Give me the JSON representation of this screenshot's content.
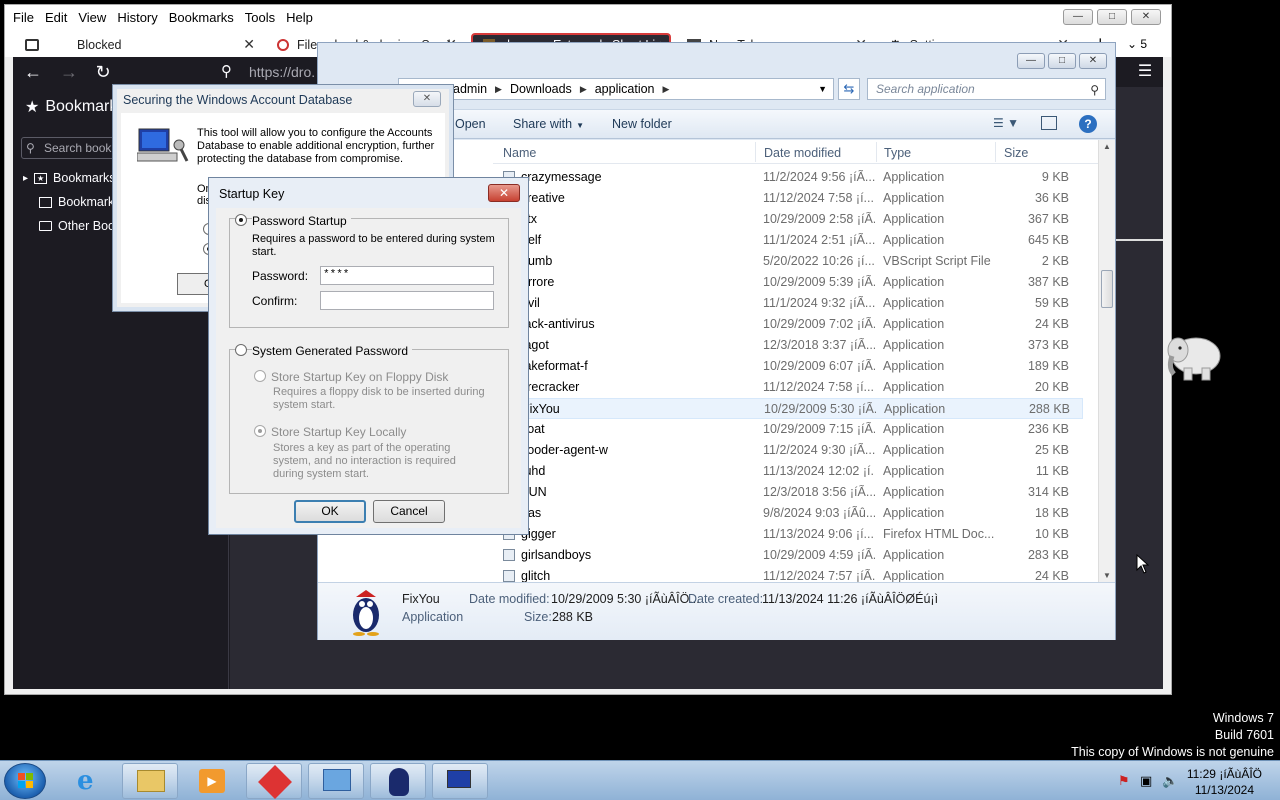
{
  "firefox": {
    "menu": [
      "File",
      "Edit",
      "View",
      "History",
      "Bookmarks",
      "Tools",
      "Help"
    ],
    "menu_accel": [
      "F",
      "E",
      "V",
      "H",
      "B",
      "T",
      "H"
    ],
    "tabs": [
      {
        "label": "Blocked"
      },
      {
        "label": "File upload & sharing. Send"
      },
      {
        "label": "dro.pm - Extremely Short Li"
      },
      {
        "label": "New Tab"
      },
      {
        "label": "Settings"
      }
    ],
    "tab_count": "5",
    "url": "https://dro.",
    "sidebar": {
      "title": "Bookmarks",
      "search_placeholder": "Search bookmarks",
      "items": [
        "Bookmarks Toolbar",
        "Bookmarks Menu",
        "Other Bookmarks"
      ]
    }
  },
  "explorer": {
    "breadcrumb": [
      "admin",
      "Downloads",
      "application"
    ],
    "search_placeholder": "Search application",
    "toolbar": {
      "open": "Open",
      "share": "Share with",
      "new_folder": "New folder"
    },
    "columns": [
      "Name",
      "Date modified",
      "Type",
      "Size"
    ],
    "files": [
      {
        "name": "crazymessage",
        "date": "11/2/2024 9:56 ¡íÃ...",
        "type": "Application",
        "size": "9 KB"
      },
      {
        "name": "creative",
        "date": "11/12/2024 7:58 ¡í...",
        "type": "Application",
        "size": "36 KB"
      },
      {
        "name": "ctx",
        "date": "10/29/2009 2:58 ¡íÃ...",
        "type": "Application",
        "size": "367 KB"
      },
      {
        "name": "delf",
        "date": "11/1/2024 2:51 ¡íÃ...",
        "type": "Application",
        "size": "645 KB"
      },
      {
        "name": "dumb",
        "date": "5/20/2022 10:26 ¡í...",
        "type": "VBScript Script File",
        "size": "2 KB"
      },
      {
        "name": "errore",
        "date": "10/29/2009 5:39 ¡íÃ...",
        "type": "Application",
        "size": "387 KB"
      },
      {
        "name": "evil",
        "date": "11/1/2024 9:32 ¡íÃ...",
        "type": "Application",
        "size": "59 KB"
      },
      {
        "name": "fack-antivirus",
        "date": "10/29/2009 7:02 ¡íÃ...",
        "type": "Application",
        "size": "24 KB"
      },
      {
        "name": "fagot",
        "date": "12/3/2018 3:37 ¡íÃ...",
        "type": "Application",
        "size": "373 KB"
      },
      {
        "name": "fakeformat-f",
        "date": "10/29/2009 6:07 ¡íÃ...",
        "type": "Application",
        "size": "189 KB"
      },
      {
        "name": "firecracker",
        "date": "11/12/2024 7:58 ¡í...",
        "type": "Application",
        "size": "20 KB"
      },
      {
        "name": "FixYou",
        "date": "10/29/2009 5:30 ¡íÃ...",
        "type": "Application",
        "size": "288 KB"
      },
      {
        "name": "float",
        "date": "10/29/2009 7:15 ¡íÃ...",
        "type": "Application",
        "size": "236 KB"
      },
      {
        "name": "flooder-agent-w",
        "date": "11/2/2024 9:30 ¡íÃ...",
        "type": "Application",
        "size": "25 KB"
      },
      {
        "name": "fuhd",
        "date": "11/13/2024 12:02 ¡í...",
        "type": "Application",
        "size": "11 KB"
      },
      {
        "name": "FUN",
        "date": "12/3/2018 3:56 ¡íÃ...",
        "type": "Application",
        "size": "314 KB"
      },
      {
        "name": "gas",
        "date": "9/8/2024 9:03 ¡íÃû...",
        "type": "Application",
        "size": "18 KB"
      },
      {
        "name": "gigger",
        "date": "11/13/2024 9:06 ¡í...",
        "type": "Firefox HTML Doc...",
        "size": "10 KB"
      },
      {
        "name": "girlsandboys",
        "date": "10/29/2009 4:59 ¡íÃ...",
        "type": "Application",
        "size": "283 KB"
      },
      {
        "name": "glitch",
        "date": "11/12/2024 7:57 ¡íÃ...",
        "type": "Application",
        "size": "24 KB"
      }
    ],
    "details": {
      "name": "FixYou",
      "kind": "Application",
      "date_modified_label": "Date modified:",
      "date_modified": "10/29/2009 5:30 ¡íÃùÂÎÖ...",
      "date_created_label": "Date created:",
      "date_created": "11/13/2024 11:26 ¡íÃùÂÎÖØÉú¡ì",
      "size_label": "Size:",
      "size": "288 KB"
    }
  },
  "secure_dialog": {
    "title": "Securing the Windows Account Database",
    "description": "This tool will allow you to configure the Accounts Database to enable additional encryption, further protecting the database from compromise.",
    "frag1": "Or",
    "frag2": "dis",
    "ok": "Ol"
  },
  "startup_key": {
    "title": "Startup Key",
    "password_startup": "Password Startup",
    "password_desc": "Requires a password to be entered during system start.",
    "password_label": "Password:",
    "password_value": "****",
    "confirm_label": "Confirm:",
    "confirm_value": "",
    "system_generated": "System Generated Password",
    "floppy_label": "Store Startup Key on Floppy Disk",
    "floppy_desc": "Requires a floppy disk to be inserted during system start.",
    "local_label": "Store Startup Key Locally",
    "local_desc": "Stores a key as part of the operating system, and no interaction is required during system start.",
    "ok": "OK",
    "cancel": "Cancel"
  },
  "desktop": {
    "watermark": [
      "Windows 7",
      "Build 7601",
      "This copy of Windows is not genuine"
    ]
  },
  "taskbar": {
    "clock_time": "11:29 ¡íÃùÂÎÖ",
    "clock_date": "11/13/2024"
  }
}
